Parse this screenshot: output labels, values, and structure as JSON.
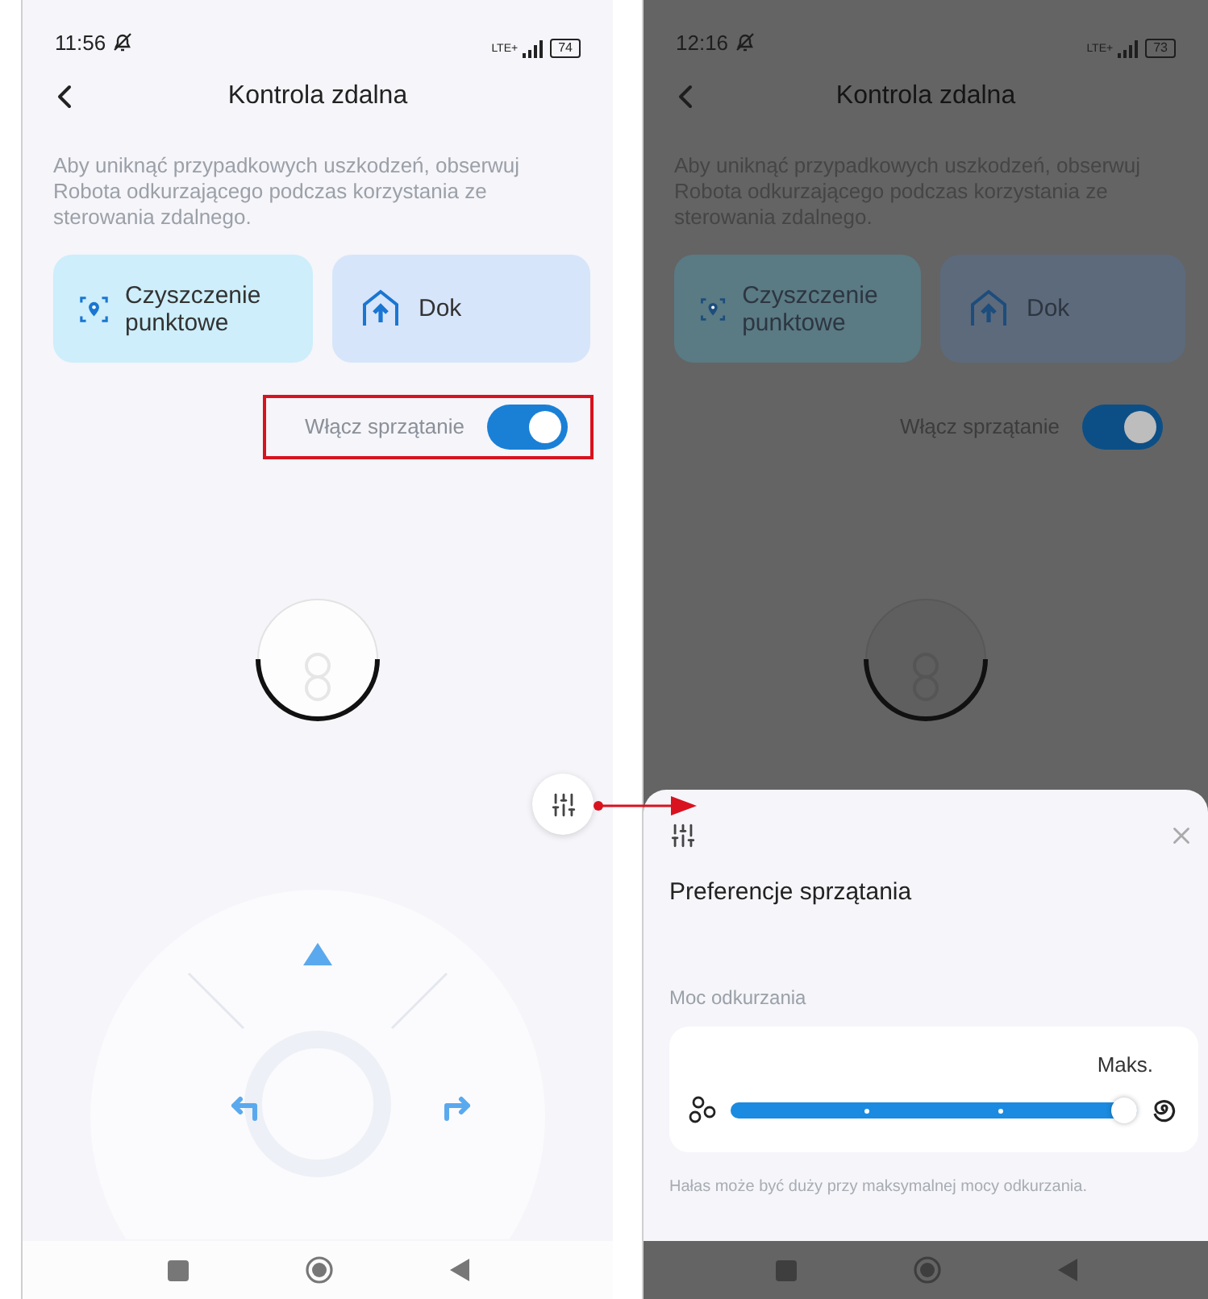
{
  "screens": [
    {
      "dimmed": false,
      "status": {
        "time": "11:56",
        "network": "LTE+",
        "battery": "74"
      },
      "title": "Kontrola zdalna",
      "description": "Aby uniknąć przypadkowych uszkodzeń, obserwuj Robota odkurzającego podczas korzystania ze sterowania zdalnego.",
      "actions": [
        {
          "kind": "spot",
          "label": "Czyszczenie punktowe"
        },
        {
          "kind": "dock",
          "label": "Dok"
        }
      ],
      "toggle": {
        "label": "Włącz sprzątanie",
        "on": true,
        "highlighted": true
      }
    },
    {
      "dimmed": true,
      "status": {
        "time": "12:16",
        "network": "LTE+",
        "battery": "73"
      },
      "title": "Kontrola zdalna",
      "description": "Aby uniknąć przypadkowych uszkodzeń, obserwuj Robota odkurzającego podczas korzystania ze sterowania zdalnego.",
      "actions": [
        {
          "kind": "spot",
          "label": "Czyszczenie punktowe"
        },
        {
          "kind": "dock",
          "label": "Dok"
        }
      ],
      "toggle": {
        "label": "Włącz sprzątanie",
        "on": true,
        "highlighted": false
      },
      "sheet": {
        "title": "Preferencje sprzątania",
        "section": "Moc odkurzania",
        "value_label": "Maks.",
        "level": 1,
        "note": "Hałas może być duży przy maksymalnej mocy odkurzania."
      }
    }
  ]
}
